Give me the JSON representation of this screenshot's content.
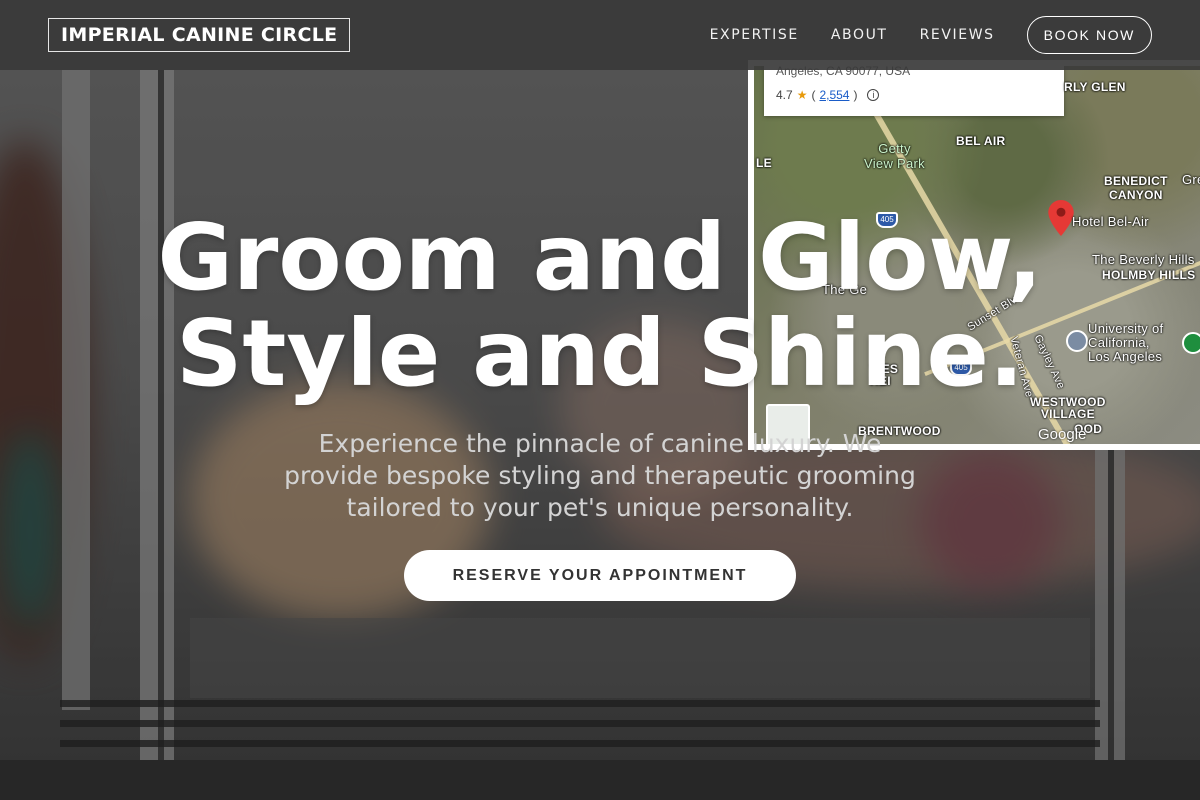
{
  "header": {
    "brand": "IMPERIAL CANINE CIRCLE",
    "nav": [
      "EXPERTISE",
      "ABOUT",
      "REVIEWS"
    ],
    "cta": "BOOK NOW"
  },
  "hero": {
    "title_line1": "Groom and Glow,",
    "title_line2": "Style and Shine.",
    "subtitle": "Experience the pinnacle of canine luxury. We provide bespoke styling and therapeutic grooming tailored to your pet's unique personality.",
    "cta": "RESERVE YOUR APPOINTMENT"
  },
  "map": {
    "address": "Angeles, CA 90077, USA",
    "rating": "4.7",
    "reviews_count": "2,554",
    "labels": {
      "beverly_glen": "RLY GLEN",
      "bel_air": "BEL AIR",
      "getty_park": "Getty\nView Park",
      "benedict_canyon": "BENEDICT\nCANYON",
      "gre": "Gre",
      "hotel": "Hotel Bel-Air",
      "beverly_hills": "The Beverly Hills",
      "holmby_hills": "HOLMBY HILLS",
      "the_ge": "The Ge",
      "ucla": "University of\nCalifornia,\nLos Angeles",
      "westwood_village": "WESTWOOD\nVILLAGE",
      "wes": "WES",
      "hei": "HEI",
      "brentwood": "BRENTWOOD",
      "ood": "OOD",
      "sunset": "Sunset Blvd",
      "veteran": "Veteran Ave",
      "gayley": "Gayley Ave",
      "shield_405a": "405",
      "shield_405b": "405",
      "le": "LE",
      "google": "Google"
    }
  },
  "colors": {
    "header_bg": "#3a3a3a",
    "cta_bg": "#ffffff",
    "pin": "#e53935",
    "star": "#e79a0c",
    "link": "#1a5cc8"
  },
  "icons": [
    "map-pin-icon",
    "star-icon",
    "info-icon",
    "university-icon",
    "park-icon",
    "highway-shield-icon"
  ]
}
